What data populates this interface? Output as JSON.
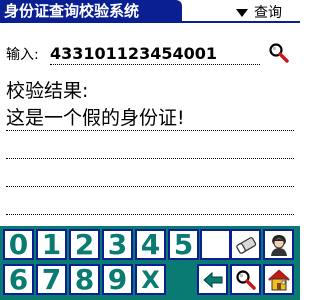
{
  "header": {
    "title": "身份证查询校验系统",
    "menu_label": "查询"
  },
  "input": {
    "label": "输入:",
    "value": "433101123454001"
  },
  "result": {
    "title": "校验结果:",
    "message": "这是一个假的身份证!"
  },
  "keypad": {
    "row1": [
      "0",
      "1",
      "2",
      "3",
      "4",
      "5"
    ],
    "row2": [
      "6",
      "7",
      "8",
      "9",
      "X"
    ]
  },
  "colors": {
    "title_bar": "#0a1f92",
    "keypad_bg": "#0a7b72",
    "key_border": "#0a1f92",
    "digit": "#0a7b72"
  },
  "icons": [
    "search-icon",
    "eraser-icon",
    "person-icon",
    "back-arrow-icon",
    "home-icon",
    "chevron-down-icon"
  ]
}
